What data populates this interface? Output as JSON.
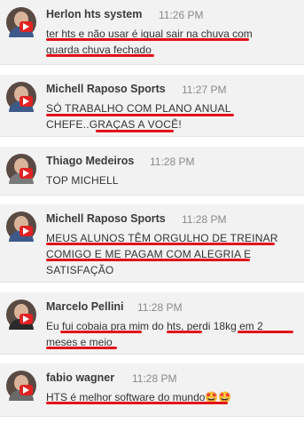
{
  "messages": [
    {
      "name": "Herlon hts system",
      "time": "11:26 PM",
      "lines": [
        "ter hts e não usar é igual sair na chuva com",
        "guarda chuva fechado"
      ]
    },
    {
      "name": "Michell Raposo Sports",
      "time": "11:27 PM",
      "lines": [
        "SÓ TRABALHO COM PLANO ANUAL",
        "CHEFE..GRAÇAS A VOCÊ!"
      ]
    },
    {
      "name": "Thiago Medeiros",
      "time": "11:28 PM",
      "lines": [
        "TOP MICHELL"
      ]
    },
    {
      "name": "Michell Raposo Sports",
      "time": "11:28 PM",
      "lines": [
        "MEUS ALUNOS TÊM ORGULHO DE TREINAR",
        "COMIGO E ME PAGAM COM ALEGRIA E",
        "SATISFAÇÃO"
      ]
    },
    {
      "name": "Marcelo Pellini",
      "time": "11:28 PM",
      "lines": [
        "Eu fui cobaia pra mim do hts, perdi 18kg em 2",
        "meses e meio"
      ]
    },
    {
      "name": "fabio wagner",
      "time": "11:28 PM",
      "lines": [
        "HTS é melhor software do mundo🤩🤩"
      ]
    }
  ],
  "colors": {
    "card_bg": "#f2f2f2",
    "underline": "#e3121a",
    "badge": "#e02222",
    "name": "#3a3a3a",
    "time": "#8a8a8a"
  },
  "icons": [
    "avatar",
    "youtube-badge-icon"
  ]
}
